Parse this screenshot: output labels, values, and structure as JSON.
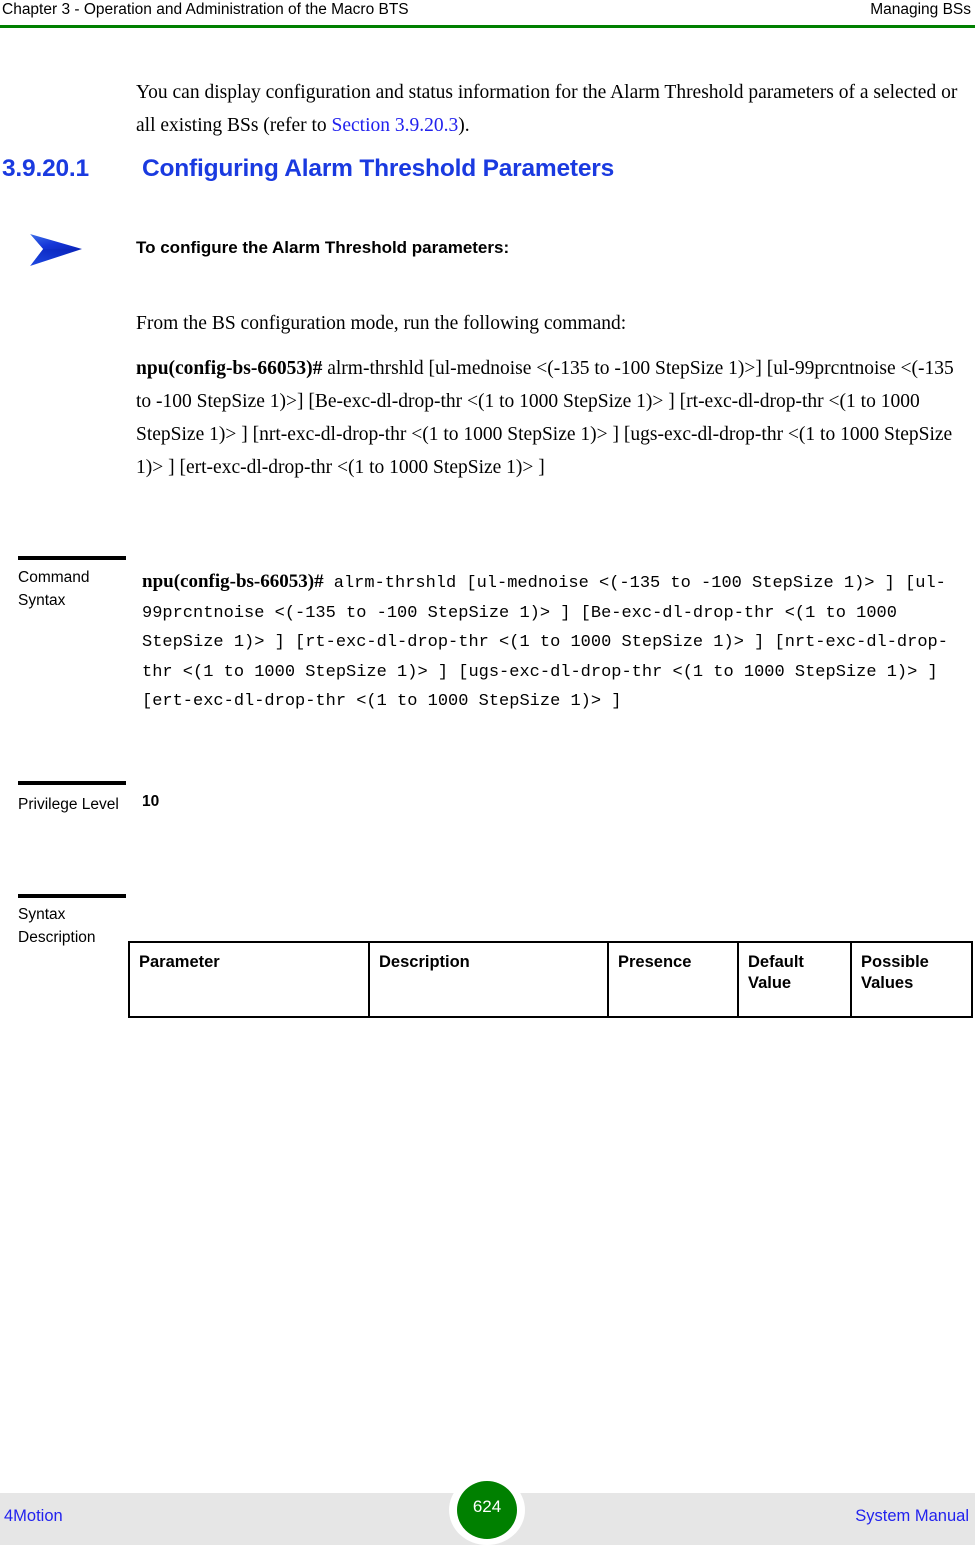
{
  "header": {
    "left": "Chapter 3 - Operation and Administration of the Macro BTS",
    "right": "Managing BSs",
    "rule_color": "#008000"
  },
  "intro": {
    "text_before": "You can display configuration and status information for the Alarm Threshold parameters of a selected or all existing BSs (refer to ",
    "link": "Section 3.9.20.3",
    "text_after": ").",
    "link_color": "#2222ee"
  },
  "heading": {
    "number": "3.9.20.1",
    "title": "Configuring Alarm Threshold Parameters",
    "color": "#1a3ae0"
  },
  "procedure": {
    "arrow_icon": "right-arrow-bullet-icon",
    "title": "To configure the Alarm Threshold parameters:"
  },
  "lead_in": {
    "text": "From the BS configuration mode, run the following command:"
  },
  "command_para": {
    "prompt": "npu(config-bs-66053)#",
    "body": " alrm-thrshld [ul-mednoise <(-135 to -100 StepSize 1)>] [ul-99prcntnoise <(-135 to -100 StepSize 1)>] [Be-exc-dl-drop-thr <(1 to 1000 StepSize 1)> ] [rt-exc-dl-drop-thr <(1 to 1000 StepSize 1)> ] [nrt-exc-dl-drop-thr <(1 to 1000 StepSize 1)> ] [ugs-exc-dl-drop-thr <(1 to 1000 StepSize 1)> ] [ert-exc-dl-drop-thr <(1 to 1000 StepSize 1)> ]"
  },
  "blocks": {
    "command_syntax": {
      "label": "Command Syntax",
      "prompt": "npu(config-bs-66053)#",
      "syntax": " alrm-thrshld [ul-mednoise <(-135 to -100 StepSize 1)> ] [ul-99prcntnoise <(-135 to -100 StepSize 1)> ] [Be-exc-dl-drop-thr <(1 to 1000 StepSize 1)> ] [rt-exc-dl-drop-thr <(1 to 1000 StepSize 1)> ] [nrt-exc-dl-drop-thr <(1 to 1000 StepSize 1)> ] [ugs-exc-dl-drop-thr <(1 to 1000 StepSize 1)> ] [ert-exc-dl-drop-thr <(1 to 1000 StepSize 1)> ]"
    },
    "privilege_level": {
      "label": "Privilege Level",
      "value": "10"
    },
    "syntax_description": {
      "label": "Syntax Description"
    }
  },
  "param_table": {
    "columns": [
      "Parameter",
      "Description",
      "Presence",
      "Default Value",
      "Possible Values"
    ],
    "rows": []
  },
  "footer": {
    "left": "4Motion",
    "page_number": "624",
    "right": "System Manual",
    "band_color": "#e6e6e6",
    "badge_color": "#008000",
    "text_color": "#2222ee"
  }
}
